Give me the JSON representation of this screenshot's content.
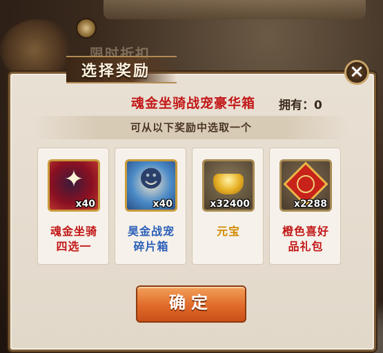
{
  "background": {
    "banner_text": "限时折扣"
  },
  "dialog": {
    "title": "选择奖励",
    "close_label": "×",
    "chest_name": "魂金坐骑战宠豪华箱",
    "owned_label": "拥有：0",
    "hint": "可从以下奖励中选取一个",
    "confirm_label": "确定"
  },
  "rewards": [
    {
      "label_line1": "魂金坐骑",
      "label_line2": "四选一",
      "quantity": "x40",
      "label_color": "#c21818",
      "icon": "mount-fan-icon"
    },
    {
      "label_line1": "昊金战宠",
      "label_line2": "碎片箱",
      "quantity": "x40",
      "label_color": "#2a5fb8",
      "icon": "pet-character-icon"
    },
    {
      "label_line1": "元宝",
      "label_line2": "",
      "quantity": "x32400",
      "label_color": "#d28a00",
      "icon": "gold-ingot-icon"
    },
    {
      "label_line1": "橙色喜好",
      "label_line2": "品礼包",
      "quantity": "x2288",
      "label_color": "#c21818",
      "icon": "gift-box-icon"
    }
  ],
  "colors": {
    "accent_red": "#c21818",
    "confirm_orange": "#e06a2a",
    "frame_gold": "#c89b3c"
  }
}
